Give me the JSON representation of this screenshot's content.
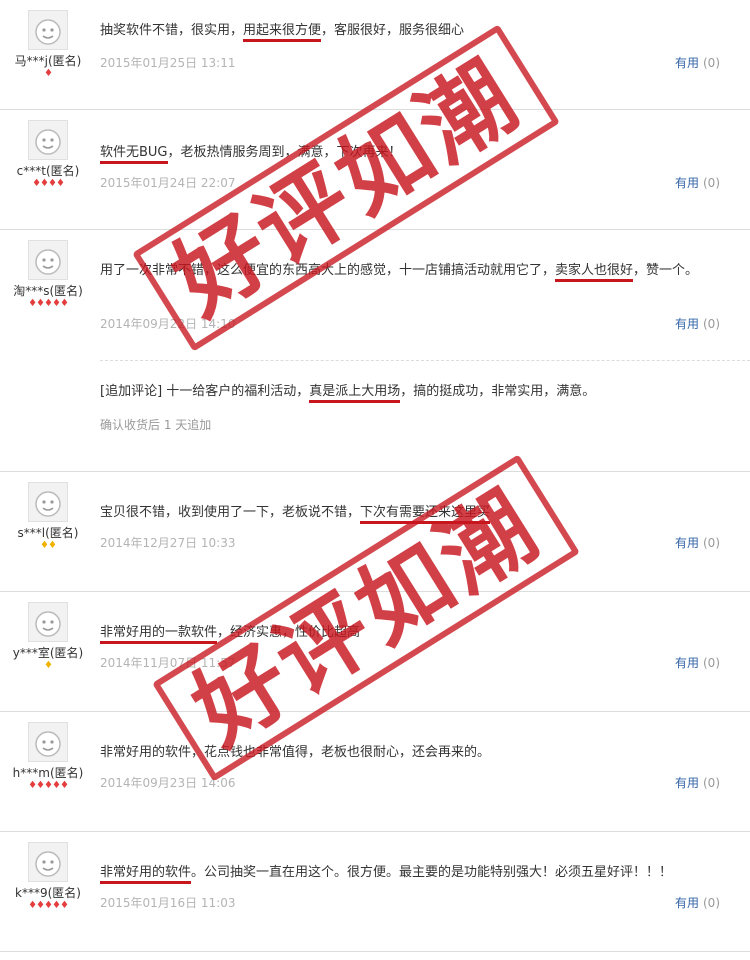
{
  "reviews": [
    {
      "user": "马***j(匿名)",
      "rank": "♦",
      "rank_color": "red",
      "content_parts": [
        {
          "text": "抽奖软件不错，很实用，",
          "u": false
        },
        {
          "text": "用起来很方便",
          "u": true
        },
        {
          "text": "，客服很好，服务很细心",
          "u": false
        }
      ],
      "date": "2015年01月25日 13:11"
    },
    {
      "user": "c***t(匿名)",
      "rank": "♦♦♦♦",
      "rank_color": "red",
      "content_parts": [
        {
          "text": "软件无BUG",
          "u": true
        },
        {
          "text": "，老板热情服务周到，满意，下次再来！",
          "u": false
        }
      ],
      "date": "2015年01月24日 22:07"
    },
    {
      "user": "淘***s(匿名)",
      "rank": "♦♦♦♦♦",
      "rank_color": "red",
      "content_parts": [
        {
          "text": "用了一次非常不错，这么便宜的东西高大上的感觉，十一店铺搞活动就用它了，",
          "u": false
        },
        {
          "text": "卖家人也很好",
          "u": true
        },
        {
          "text": "，赞一个。",
          "u": false
        }
      ],
      "date": "2014年09月22日 14:10",
      "followup_parts": [
        {
          "text": "[追加评论] 十一给客户的福利活动，",
          "u": false
        },
        {
          "text": "真是派上大用场",
          "u": true
        },
        {
          "text": "，搞的挺成功，非常实用，满意。",
          "u": false
        }
      ],
      "followup_date": "确认收货后 1 天追加"
    },
    {
      "user": "s***l(匿名)",
      "rank": "♦♦",
      "rank_color": "gold",
      "content_parts": [
        {
          "text": "宝贝很不错，收到使用了一下，老板说不错，",
          "u": false
        },
        {
          "text": "下次有需要还来这里买",
          "u": true
        }
      ],
      "date": "2014年12月27日 10:33"
    },
    {
      "user": "y***室(匿名)",
      "rank": "♦",
      "rank_color": "gold",
      "content_parts": [
        {
          "text": "非常好用的一款软件",
          "u": true
        },
        {
          "text": "，经济实惠，性价比超高",
          "u": false
        }
      ],
      "date": "2014年11月07日 11:57"
    },
    {
      "user": "h***m(匿名)",
      "rank": "♦♦♦♦♦",
      "rank_color": "red",
      "content_parts": [
        {
          "text": "非常好用的软件，花点钱也非常值得，老板也很耐心，还会再来的。",
          "u": false
        }
      ],
      "date": "2014年09月23日 14:06"
    },
    {
      "user": "k***9(匿名)",
      "rank": "♦♦♦♦♦",
      "rank_color": "red",
      "content_parts": [
        {
          "text": "非常好用的软件",
          "u": true
        },
        {
          "text": "。公司抽奖一直在用这个。很方便。最主要的是功能特别强大！必须五星好评！！！",
          "u": false
        }
      ],
      "date": "2015年01月16日 11:03"
    }
  ],
  "useful_label": "有用",
  "useful_count": "(0)",
  "stamp_text": "好评如潮",
  "colors": {
    "stamp": "#c8161d",
    "link": "#3366aa",
    "date": "#b4b4b4"
  }
}
